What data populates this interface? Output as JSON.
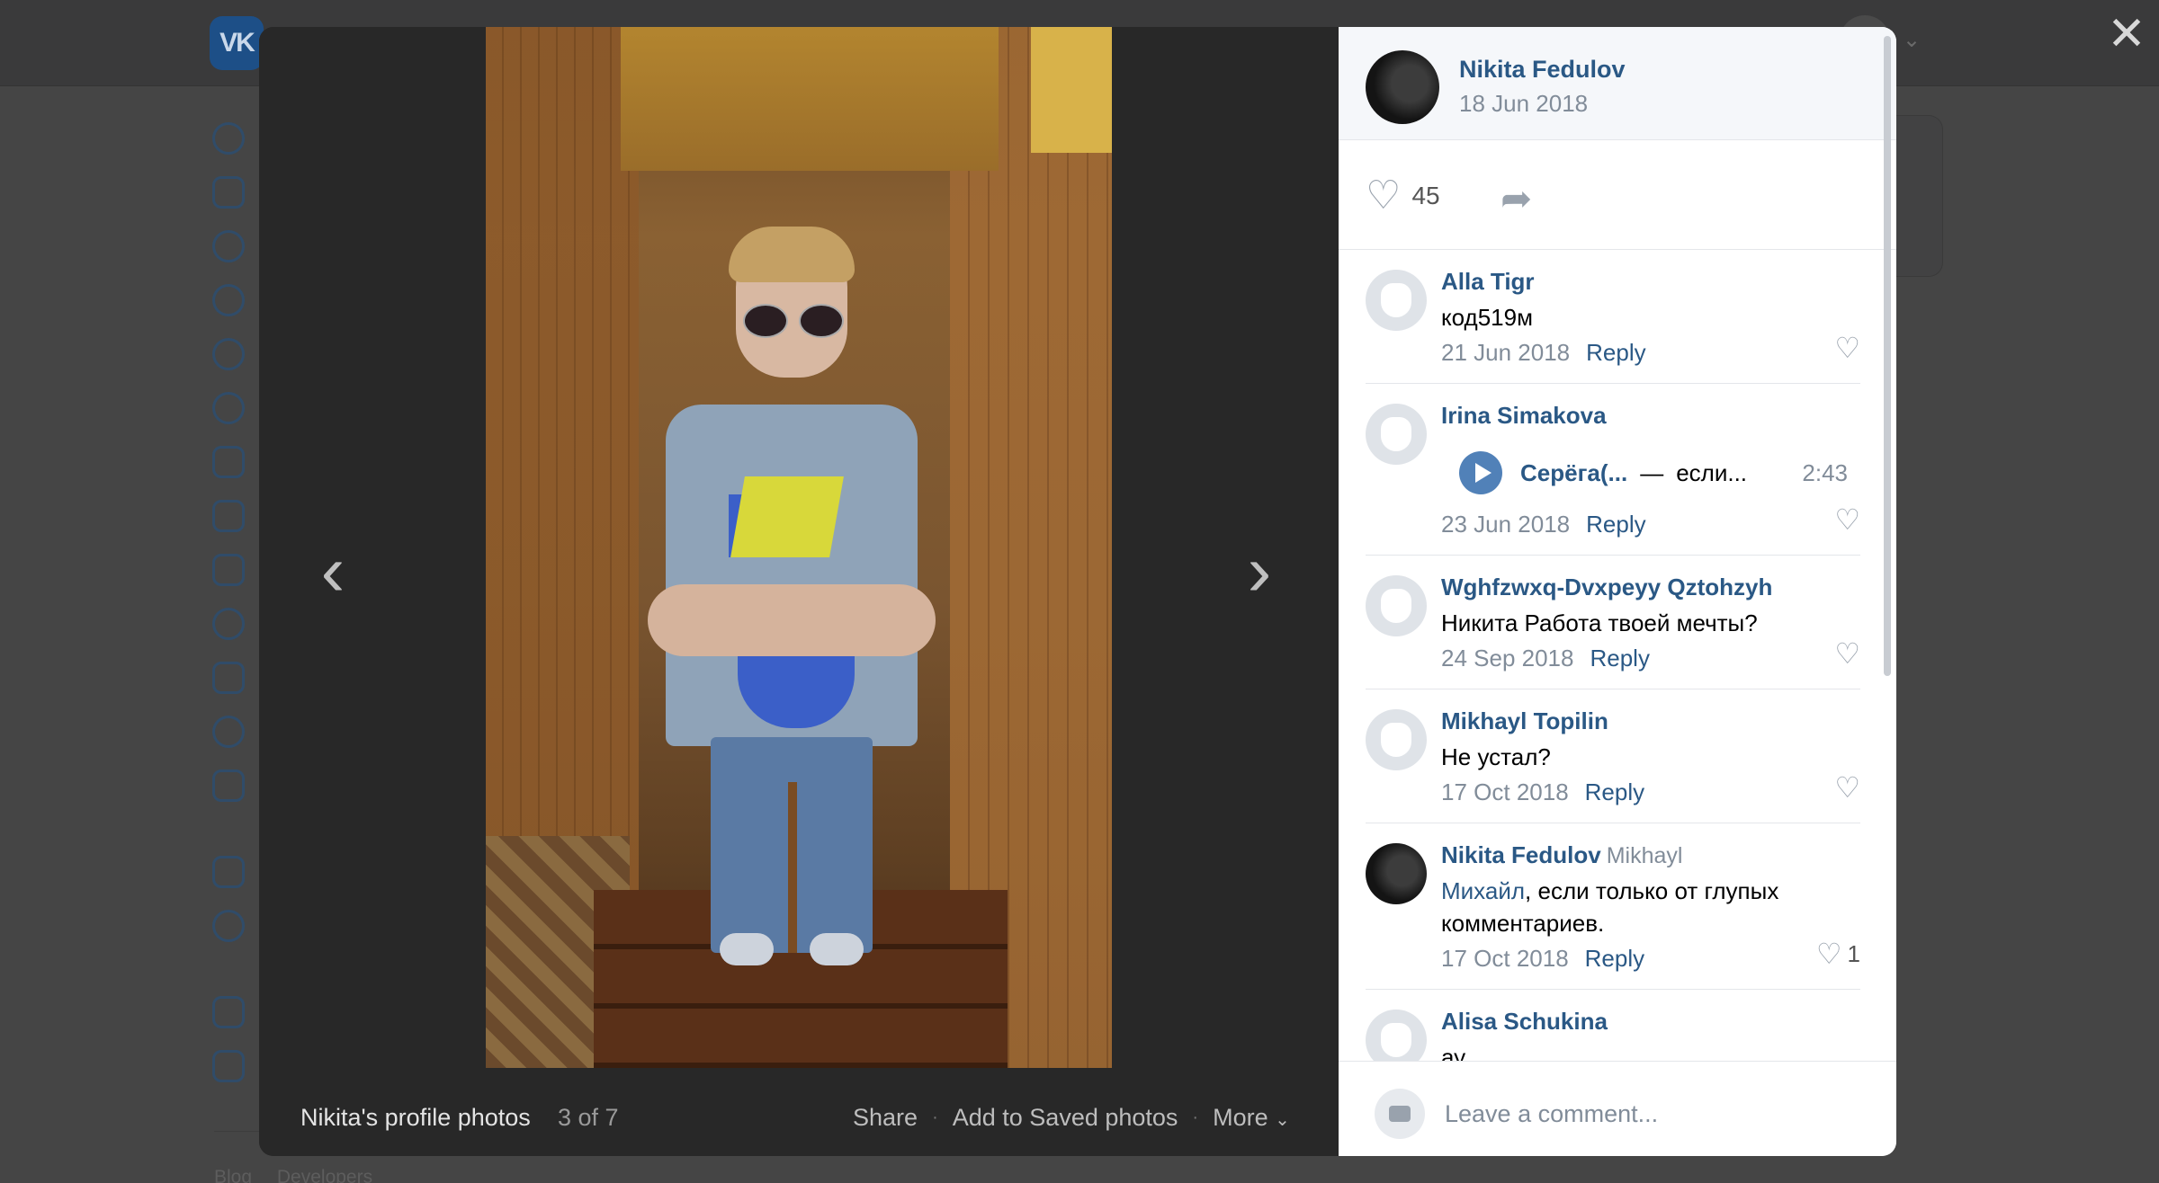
{
  "background": {
    "logo_text": "VK",
    "footer_links": [
      "Blog",
      "Developers"
    ]
  },
  "viewer": {
    "album_title": "Nikita's profile photos",
    "counter": "3 of 7",
    "actions": {
      "share": "Share",
      "save": "Add to Saved photos",
      "more": "More"
    },
    "prev_icon": "chevron-left-icon",
    "next_icon": "chevron-right-icon",
    "close_icon": "close-icon"
  },
  "post": {
    "author": "Nikita Fedulov",
    "date": "18 Jun 2018",
    "likes": "45"
  },
  "comments": [
    {
      "name": "Alla Tigr",
      "text": "код519м",
      "date": "21 Jun 2018",
      "reply_label": "Reply",
      "likes": ""
    },
    {
      "name": "Irina Simakova",
      "audio": {
        "artist": "Серёга(...",
        "separator": "—",
        "track": "если...",
        "duration": "2:43"
      },
      "date": "23 Jun 2018",
      "reply_label": "Reply",
      "likes": ""
    },
    {
      "name": "Wghfzwxq-Dvxpeyy Qztohzyh",
      "text": "Никита Работа твоей мечты?",
      "date": "24 Sep 2018",
      "reply_label": "Reply",
      "likes": ""
    },
    {
      "name": "Mikhayl Topilin",
      "text": "Не устал?",
      "date": "17 Oct 2018",
      "reply_label": "Reply",
      "likes": ""
    },
    {
      "name": "Nikita Fedulov",
      "reply_to": "Mikhayl",
      "mention": "Михайл",
      "text": ", если только от глупых комментариев.",
      "date": "17 Oct 2018",
      "reply_label": "Reply",
      "likes": "1"
    },
    {
      "name": "Alisa Schukina",
      "text": "ау",
      "date": "",
      "reply_label": "",
      "likes": ""
    }
  ],
  "composer": {
    "placeholder": "Leave a comment..."
  }
}
